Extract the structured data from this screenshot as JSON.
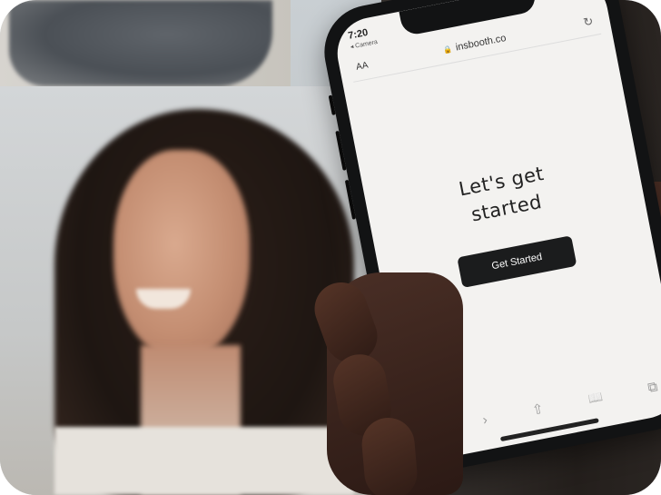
{
  "phone": {
    "status_time": "7:20",
    "status_signal": "▪▪▮ ◠ ▭",
    "back_label": "◂ Camera",
    "aa_label": "AA",
    "url": "insbooth.co",
    "heading_line1": "Let's get",
    "heading_line2": "started",
    "cta_label": "Get Started"
  },
  "icons": {
    "lock": "🔒",
    "reload": "↻",
    "back": "‹",
    "forward": "›",
    "share": "⇧",
    "bookmarks": "📖",
    "tabs": "⧉"
  }
}
